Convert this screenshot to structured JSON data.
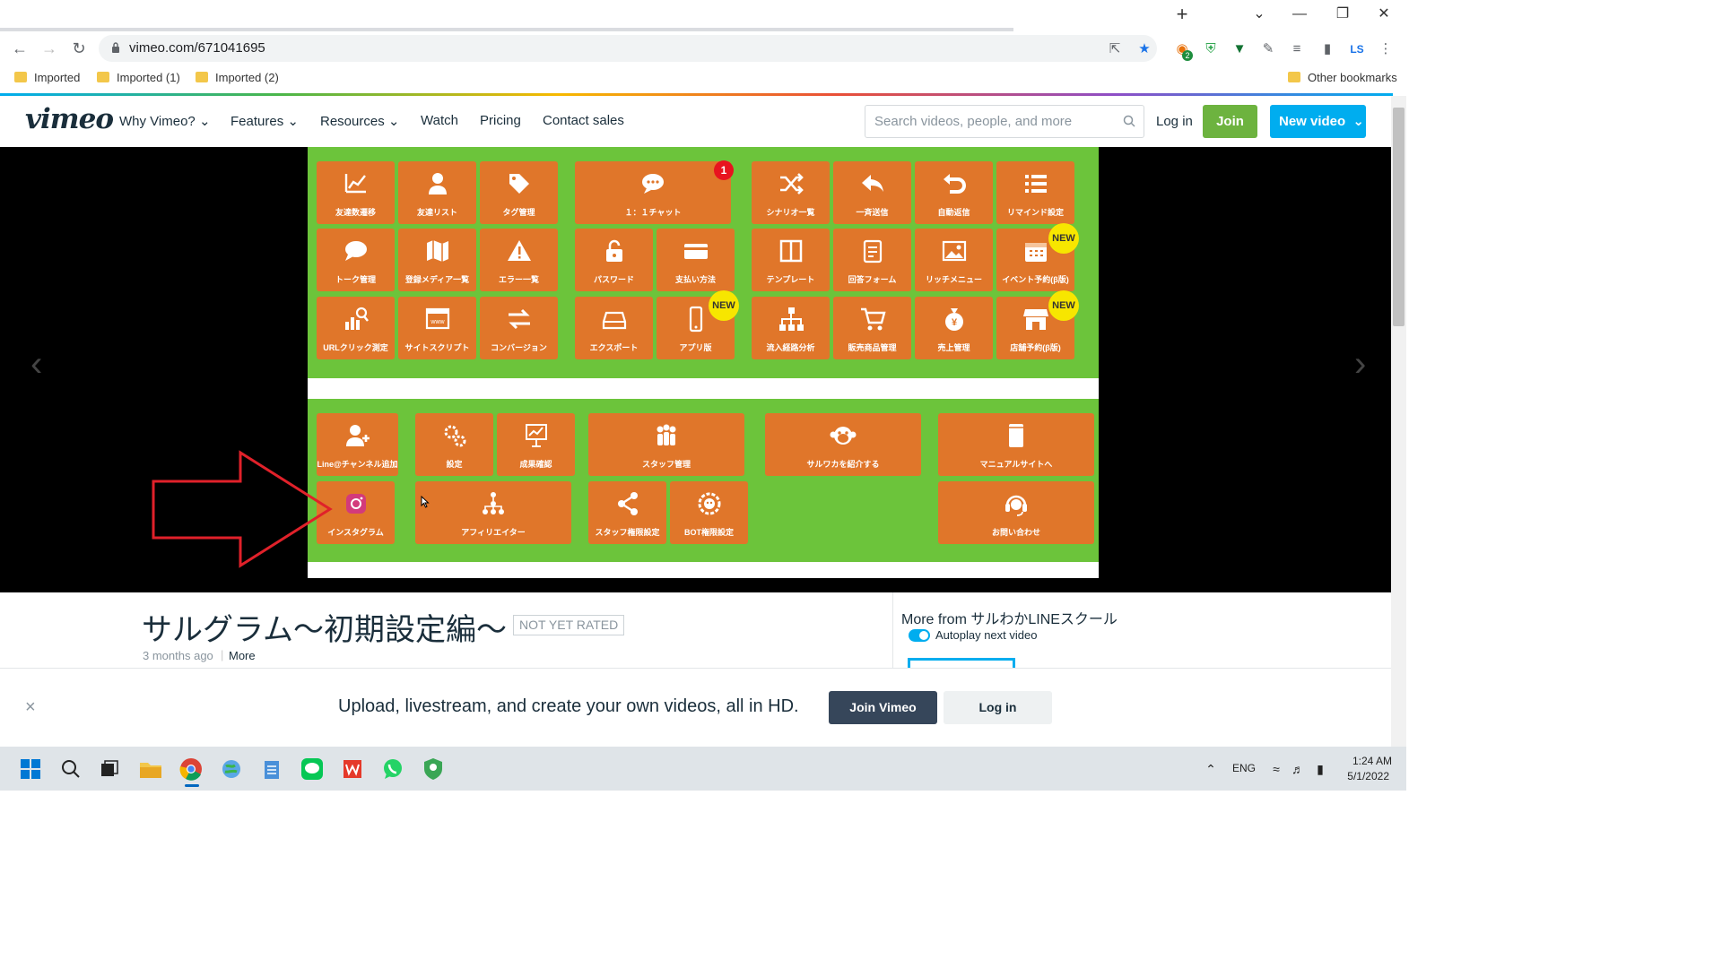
{
  "browser": {
    "url": "vimeo.com/671041695",
    "bookmarks": [
      "Imported",
      "Imported (1)",
      "Imported (2)"
    ],
    "other_bookmarks": "Other bookmarks",
    "new_tab": "+",
    "profile_initials": "LS",
    "extension_badge": "2"
  },
  "vimeo": {
    "logo": "vimeo",
    "nav": [
      "Why Vimeo?",
      "Features",
      "Resources",
      "Watch",
      "Pricing",
      "Contact sales"
    ],
    "search_placeholder": "Search videos, people, and more",
    "login": "Log in",
    "join": "Join",
    "new_video": "New video"
  },
  "slide": {
    "top_tiles": [
      "友達数遷移",
      "友達リスト",
      "タグ管理",
      "１：１チャット",
      "シナリオ一覧",
      "一斉送信",
      "自動返信",
      "リマインド設定",
      "トーク管理",
      "登録メディア一覧",
      "エラー一覧",
      "パスワード",
      "支払い方法",
      "テンプレート",
      "回答フォーム",
      "リッチメニュー",
      "イベント予約(β版)",
      "URLクリック測定",
      "サイトスクリプト",
      "コンバージョン",
      "エクスポート",
      "アプリ版",
      "流入経路分析",
      "販売商品管理",
      "売上管理",
      "店舗予約(β版)"
    ],
    "bottom_tiles": [
      "Line@チャンネル追加",
      "設定",
      "成果確認",
      "スタッフ管理",
      "サルワカを紹介する",
      "マニュアルサイトへ",
      "インスタグラム",
      "アフィリエイター",
      "スタッフ権限設定",
      "BOT権限設定",
      "お問い合わせ"
    ],
    "new_badge": "NEW",
    "chat_badge": "1",
    "colors": {
      "background": "#6cc43b",
      "tile": "#e0762a",
      "arrow": "#e0212a"
    }
  },
  "video": {
    "title": "サルグラム～初期設定編～",
    "rating": "NOT YET RATED",
    "time": "3 months ago",
    "more": "More",
    "more_from": "More from サルわかLINEスクール",
    "autoplay": "Autoplay next video"
  },
  "banner": {
    "text": "Upload, livestream, and create your own videos, all in HD.",
    "join": "Join Vimeo",
    "login": "Log in",
    "close": "×"
  },
  "taskbar": {
    "lang": "ENG",
    "time": "1:24 AM",
    "date": "5/1/2022"
  }
}
